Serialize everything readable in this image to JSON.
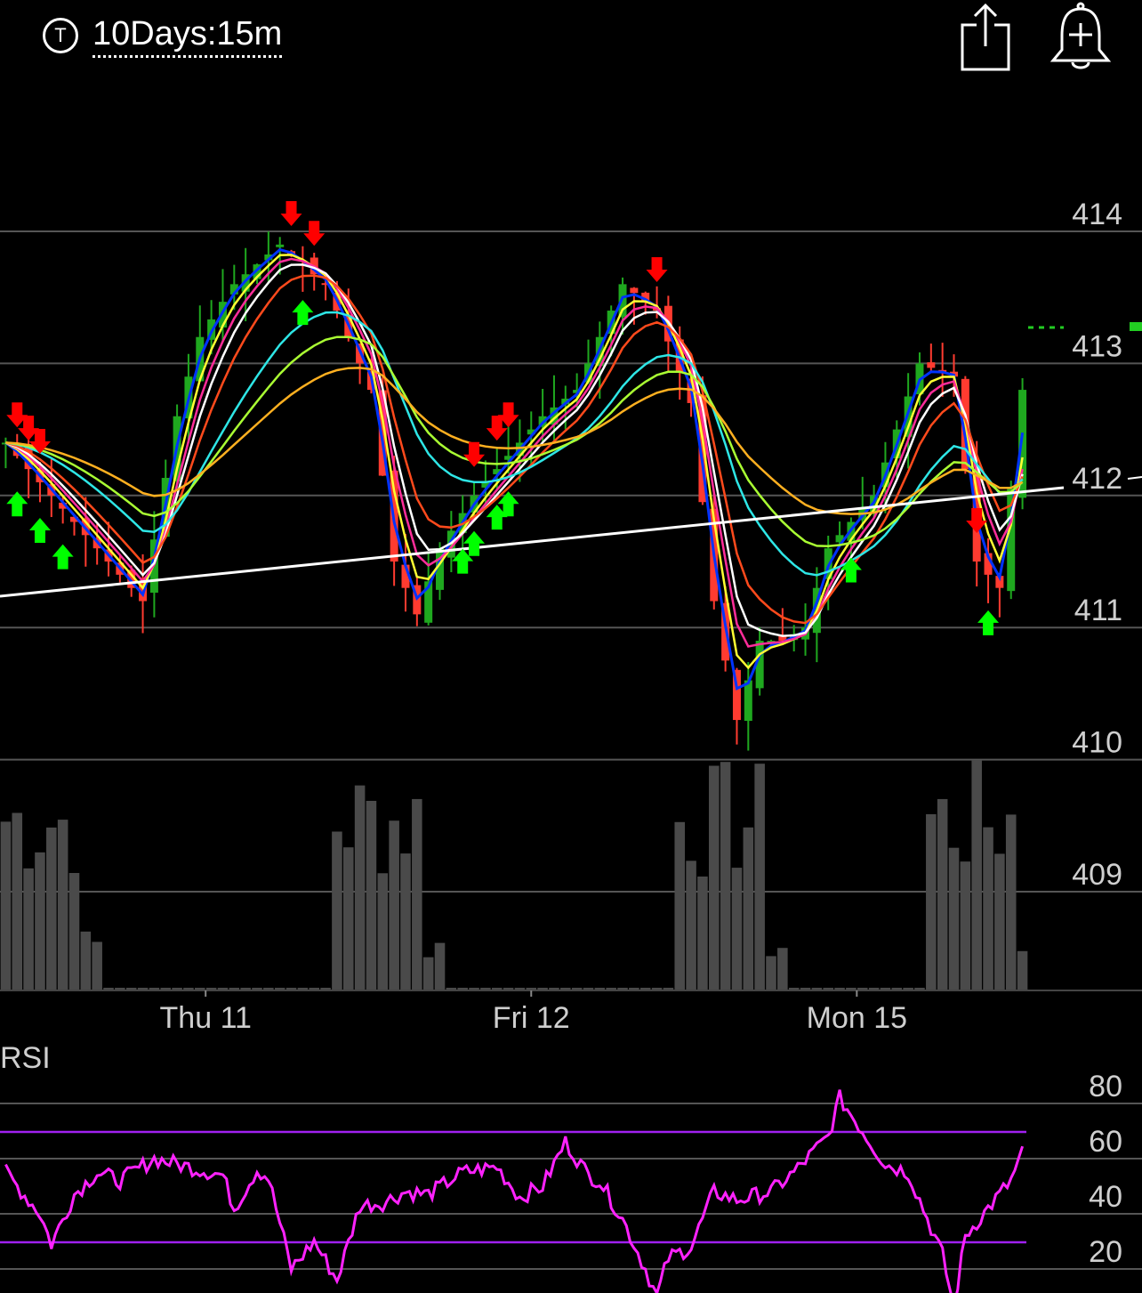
{
  "header": {
    "ticker_icon_label": "T",
    "timeframe": "10Days:15m",
    "share_icon": "share-icon",
    "alert_icon": "add-alert-bell-icon"
  },
  "chart_data": [
    {
      "type": "candlestick",
      "title": "",
      "y_ticks": [
        "414",
        "413",
        "412",
        "411",
        "410",
        "409"
      ],
      "x_ticks": [
        "Thu 11",
        "Fri 12",
        "Mon 15"
      ],
      "ylim": [
        408.2,
        414.9
      ],
      "last_price": 413.1,
      "grid": true,
      "approx_close_path": [
        [
          0,
          412.4
        ],
        [
          8,
          411.6
        ],
        [
          12,
          411.2
        ],
        [
          15,
          412.6
        ],
        [
          17,
          413.2
        ],
        [
          20,
          413.6
        ],
        [
          24,
          413.9
        ],
        [
          28,
          413.6
        ],
        [
          32,
          412.8
        ],
        [
          34,
          411.5
        ],
        [
          36,
          411.1
        ],
        [
          38,
          411.6
        ],
        [
          41,
          412.0
        ],
        [
          44,
          412.3
        ],
        [
          47,
          412.6
        ],
        [
          50,
          412.8
        ],
        [
          54,
          413.6
        ],
        [
          57,
          413.4
        ],
        [
          60,
          412.7
        ],
        [
          62,
          411.2
        ],
        [
          64,
          410.3
        ],
        [
          66,
          410.9
        ],
        [
          68,
          410.9
        ],
        [
          70,
          411.0
        ],
        [
          72,
          411.6
        ],
        [
          76,
          412.0
        ],
        [
          80,
          413.0
        ],
        [
          83,
          412.9
        ],
        [
          85,
          411.5
        ],
        [
          87,
          411.3
        ],
        [
          89,
          412.8
        ]
      ],
      "moving_averages": [
        {
          "color": "#0033ff"
        },
        {
          "color": "#ffff33"
        },
        {
          "color": "#ff2d9a"
        },
        {
          "color": "#ffffff"
        },
        {
          "color": "#ff4a1c"
        },
        {
          "color": "#2ee6e6"
        },
        {
          "color": "#aaff33"
        },
        {
          "color": "#ffb020"
        }
      ],
      "trendline": {
        "color": "#ffffff"
      },
      "signals": {
        "buy_color": "#00ff00",
        "sell_color": "#ff0000"
      },
      "volume": {
        "color": "#4a4a4a"
      }
    },
    {
      "type": "line",
      "title": "RSI",
      "y_ticks": [
        "80",
        "60",
        "40",
        "20"
      ],
      "ylim": [
        0,
        92
      ],
      "overbought": 60,
      "oversold": 20,
      "band_color": "#a020f0",
      "line_color": "#ff22ff",
      "approx_values": [
        [
          0,
          55
        ],
        [
          3,
          40
        ],
        [
          4,
          29
        ],
        [
          6,
          47
        ],
        [
          8,
          55
        ],
        [
          10,
          52
        ],
        [
          13,
          60
        ],
        [
          16,
          57
        ],
        [
          19,
          54
        ],
        [
          20,
          42
        ],
        [
          22,
          56
        ],
        [
          23,
          53
        ],
        [
          25,
          20
        ],
        [
          27,
          30
        ],
        [
          29,
          16
        ],
        [
          31,
          43
        ],
        [
          33,
          44
        ],
        [
          35,
          48
        ],
        [
          37,
          47
        ],
        [
          40,
          55
        ],
        [
          43,
          57
        ],
        [
          45,
          46
        ],
        [
          47,
          50
        ],
        [
          49,
          66
        ],
        [
          51,
          54
        ],
        [
          52,
          52
        ],
        [
          54,
          38
        ],
        [
          56,
          20
        ],
        [
          57,
          10
        ],
        [
          58,
          24
        ],
        [
          60,
          28
        ],
        [
          62,
          48
        ],
        [
          64,
          45
        ],
        [
          67,
          48
        ],
        [
          69,
          55
        ],
        [
          72,
          68
        ],
        [
          73,
          82
        ],
        [
          75,
          70
        ],
        [
          77,
          58
        ],
        [
          79,
          55
        ],
        [
          82,
          25
        ],
        [
          83,
          6
        ],
        [
          84,
          32
        ],
        [
          86,
          42
        ],
        [
          88,
          52
        ],
        [
          89,
          62
        ]
      ]
    }
  ]
}
